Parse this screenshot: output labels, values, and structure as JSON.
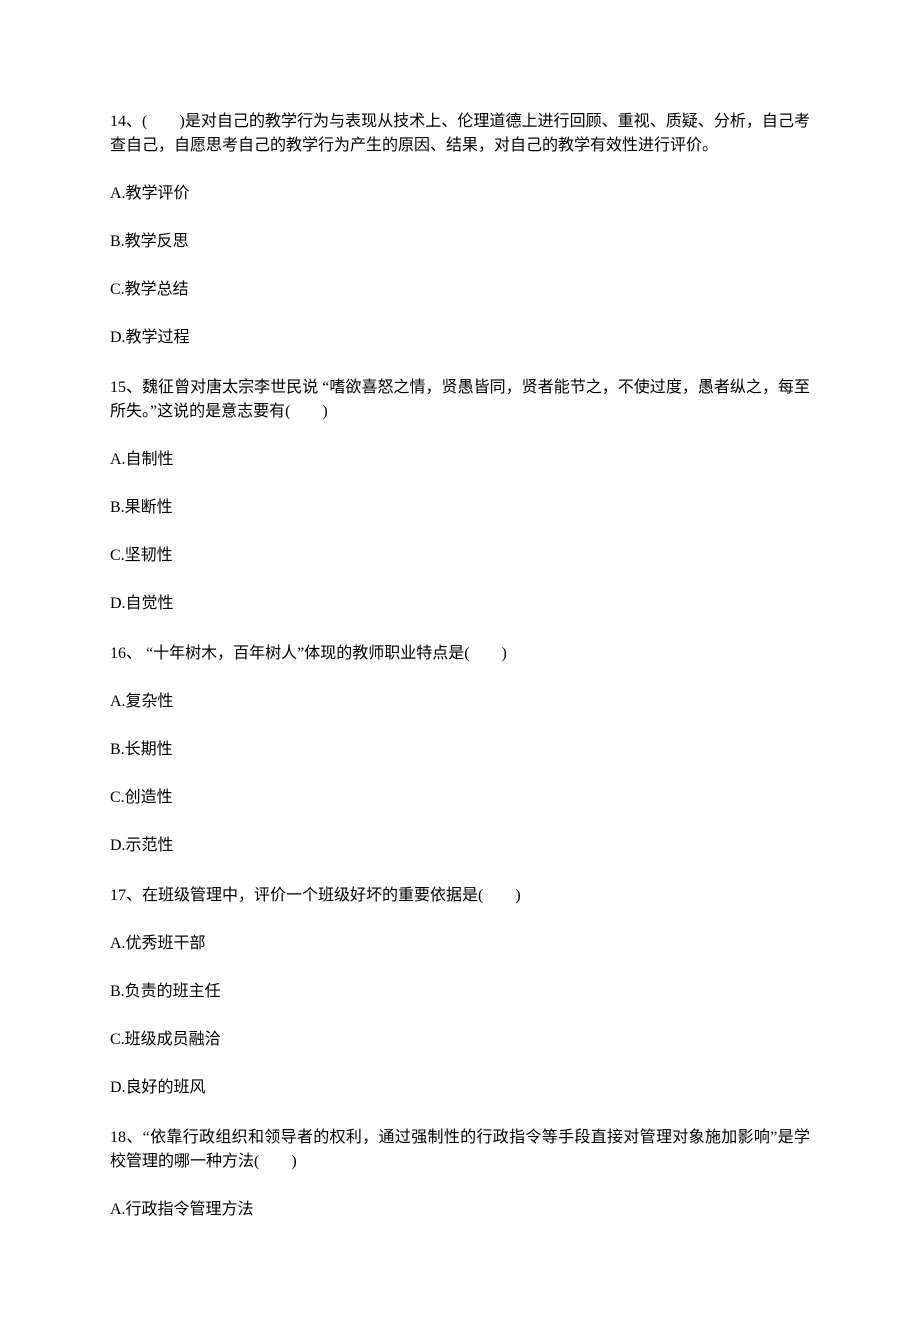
{
  "questions": [
    {
      "stem": "14、(　　)是对自己的教学行为与表现从技术上、伦理道德上进行回顾、重视、质疑、分析，自己考查自己，自愿思考自己的教学行为产生的原因、结果，对自己的教学有效性进行评价。",
      "options": [
        "A.教学评价",
        "B.教学反思",
        "C.教学总结",
        "D.教学过程"
      ]
    },
    {
      "stem": "15、魏征曾对唐太宗李世民说 “嗜欲喜怒之情，贤愚皆同，贤者能节之，不使过度，愚者纵之，每至所失。”这说的是意志要有(　　)",
      "options": [
        "A.自制性",
        "B.果断性",
        "C.坚韧性",
        "D.自觉性"
      ]
    },
    {
      "stem": "16、 “十年树木，百年树人”体现的教师职业特点是(　　)",
      "options": [
        "A.复杂性",
        "B.长期性",
        "C.创造性",
        "D.示范性"
      ]
    },
    {
      "stem": "17、在班级管理中，评价一个班级好坏的重要依据是(　　)",
      "options": [
        "A.优秀班干部",
        "B.负责的班主任",
        "C.班级成员融洽",
        "D.良好的班风"
      ]
    },
    {
      "stem": "18、“依靠行政组织和领导者的权利，通过强制性的行政指令等手段直接对管理对象施加影响”是学校管理的哪一种方法(　　)",
      "options": [
        "A.行政指令管理方法"
      ]
    }
  ]
}
